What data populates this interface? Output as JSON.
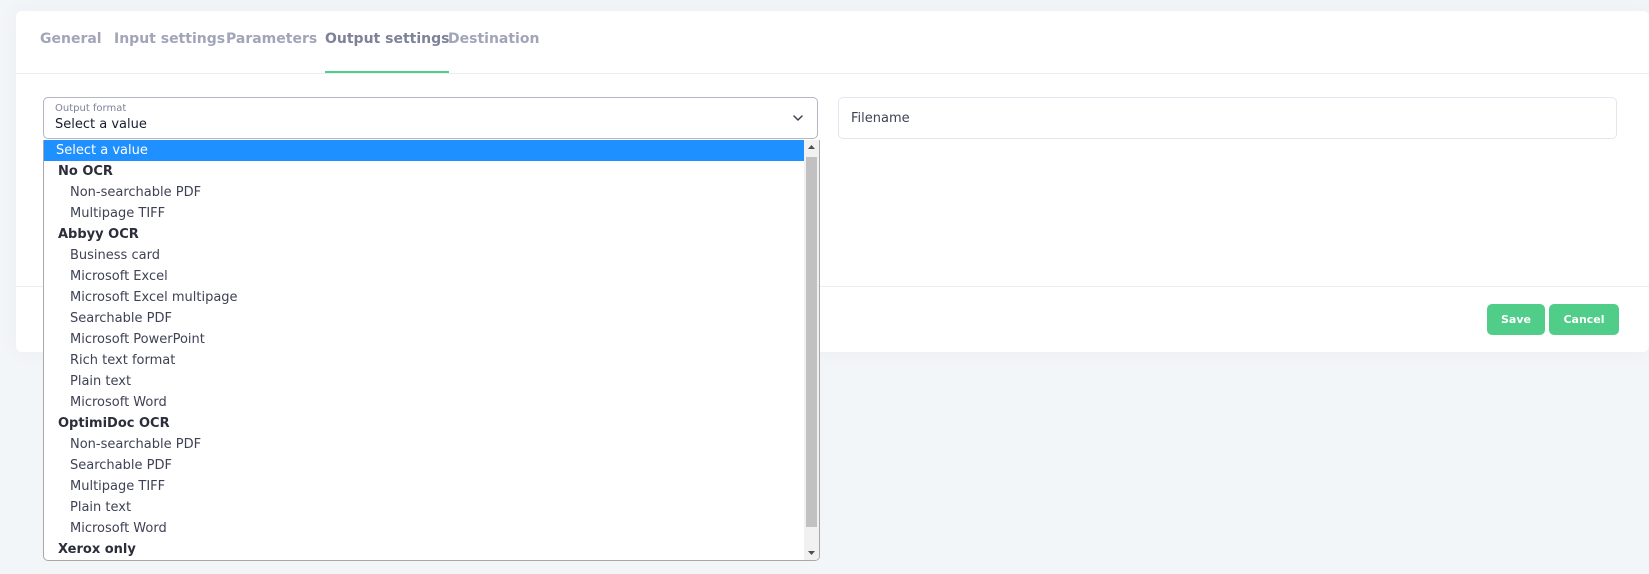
{
  "tabs": [
    {
      "label": "General"
    },
    {
      "label": "Input settings"
    },
    {
      "label": "Parameters"
    },
    {
      "label": "Output settings"
    },
    {
      "label": "Destination"
    }
  ],
  "active_tab": "Output settings",
  "output_format": {
    "label": "Output format",
    "value": "Select a value"
  },
  "filename": {
    "placeholder": "Filename"
  },
  "buttons": {
    "save": "Save",
    "cancel": "Cancel"
  },
  "dropdown": {
    "selected": "Select a value",
    "items": [
      {
        "label": "Select a value",
        "kind": "option"
      },
      {
        "label": "No OCR",
        "kind": "group"
      },
      {
        "label": "Non-searchable PDF",
        "kind": "option"
      },
      {
        "label": "Multipage TIFF",
        "kind": "option"
      },
      {
        "label": "Abbyy OCR",
        "kind": "group"
      },
      {
        "label": "Business card",
        "kind": "option"
      },
      {
        "label": "Microsoft Excel",
        "kind": "option"
      },
      {
        "label": "Microsoft Excel multipage",
        "kind": "option"
      },
      {
        "label": "Searchable PDF",
        "kind": "option"
      },
      {
        "label": "Microsoft PowerPoint",
        "kind": "option"
      },
      {
        "label": "Rich text format",
        "kind": "option"
      },
      {
        "label": "Plain text",
        "kind": "option"
      },
      {
        "label": "Microsoft Word",
        "kind": "option"
      },
      {
        "label": "OptimiDoc OCR",
        "kind": "group"
      },
      {
        "label": "Non-searchable PDF",
        "kind": "option"
      },
      {
        "label": "Searchable PDF",
        "kind": "option"
      },
      {
        "label": "Multipage TIFF",
        "kind": "option"
      },
      {
        "label": "Plain text",
        "kind": "option"
      },
      {
        "label": "Microsoft Word",
        "kind": "option"
      },
      {
        "label": "Xerox only",
        "kind": "group"
      }
    ]
  },
  "colors": {
    "accent": "#50cd89",
    "selection": "#1e90ff",
    "background": "#f3f6f9"
  }
}
